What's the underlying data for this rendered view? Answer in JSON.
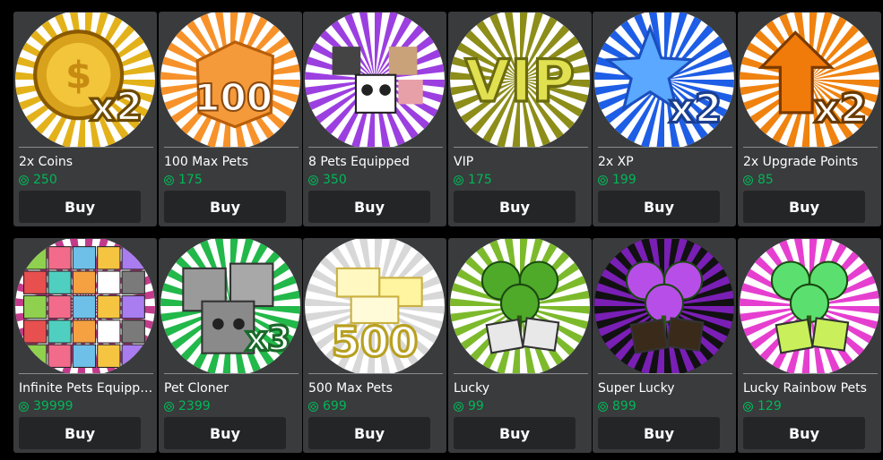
{
  "items": [
    {
      "name": "2x Coins",
      "price": "250",
      "buy_label": "Buy",
      "icon": "gold-coin-x2-icon",
      "colors": [
        "#e3b21a",
        "#ffffff",
        "#f7cd2e"
      ]
    },
    {
      "name": "100 Max Pets",
      "price": "175",
      "buy_label": "Buy",
      "icon": "orange-crate-100-icon",
      "colors": [
        "#f7922a",
        "#ffffff",
        "#fcbb6c"
      ]
    },
    {
      "name": "8 Pets Equipped",
      "price": "350",
      "buy_label": "Buy",
      "icon": "pets-group-icon",
      "colors": [
        "#9c3fe0",
        "#ffffff",
        "#d9a8f5"
      ]
    },
    {
      "name": "VIP",
      "price": "175",
      "buy_label": "Buy",
      "icon": "vip-icon",
      "colors": [
        "#8d8d1a",
        "#ffffff",
        "#b5b521"
      ]
    },
    {
      "name": "2x XP",
      "price": "199",
      "buy_label": "Buy",
      "icon": "blue-star-x2-icon",
      "colors": [
        "#1e5ee6",
        "#ffffff",
        "#4da4ff"
      ]
    },
    {
      "name": "2x Upgrade Points",
      "price": "85",
      "buy_label": "Buy",
      "icon": "orange-arrow-x2-icon",
      "colors": [
        "#f0820f",
        "#ffffff",
        "#ff9a1f"
      ]
    },
    {
      "name": "Infinite Pets Equipped",
      "price": "39999",
      "buy_label": "Buy",
      "icon": "many-pets-icon",
      "colors": [
        "#c23b8b",
        "#ffffff",
        "#6fc0e8"
      ]
    },
    {
      "name": "Pet Cloner",
      "price": "2399",
      "buy_label": "Buy",
      "icon": "cat-clone-x3-icon",
      "colors": [
        "#22b84a",
        "#ffffff",
        "#9a9a9a"
      ]
    },
    {
      "name": "500 Max Pets",
      "price": "699",
      "buy_label": "Buy",
      "icon": "white-crates-500-icon",
      "colors": [
        "#d8d8d8",
        "#ffffff",
        "#fff3a8"
      ]
    },
    {
      "name": "Lucky",
      "price": "99",
      "buy_label": "Buy",
      "icon": "clover-dice-icon",
      "colors": [
        "#7cba2c",
        "#ffffff",
        "#5cb82a"
      ]
    },
    {
      "name": "Super Lucky",
      "price": "899",
      "buy_label": "Buy",
      "icon": "purple-clover-dice-icon",
      "colors": [
        "#7a1fb5",
        "#111111",
        "#c66cf0"
      ]
    },
    {
      "name": "Lucky Rainbow Pets",
      "price": "129",
      "buy_label": "Buy",
      "icon": "rainbow-clover-dice-icon",
      "colors": [
        "#e63fd0",
        "#ffffff",
        "#57d96a"
      ]
    }
  ]
}
